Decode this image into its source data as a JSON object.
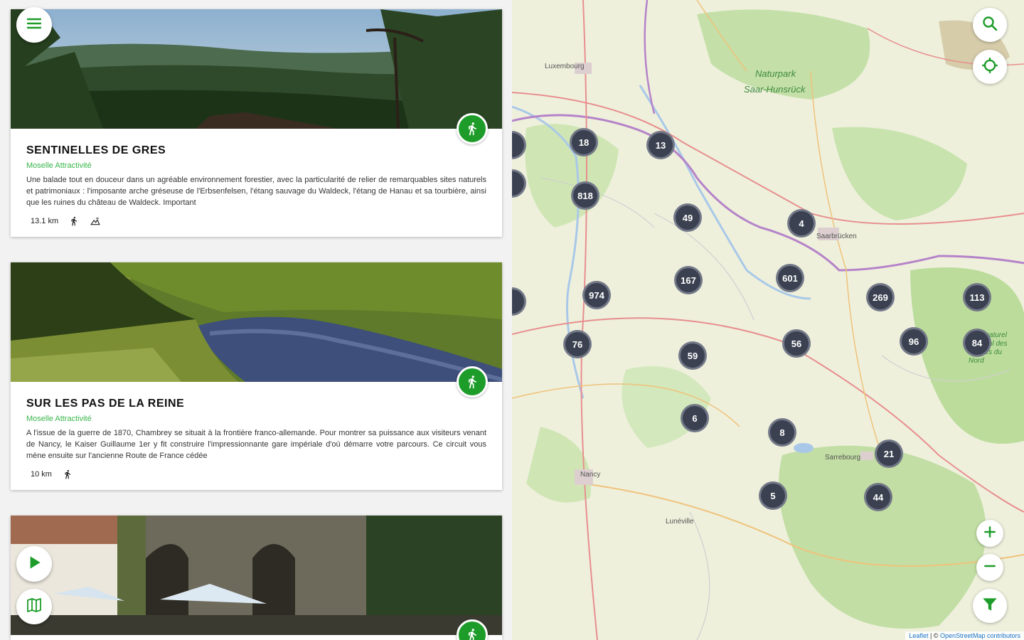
{
  "cards": [
    {
      "title": "SENTINELLES DE GRES",
      "source": "Moselle Attractivité",
      "description": "Une balade tout en douceur dans un agréable environnement forestier, avec la particularité de relier de remarquables sites naturels et patrimoniaux : l'imposante arche gréseuse de l'Erbsenfelsen, l'étang sauvage du Waldeck, l'étang de Hanau et sa tourbière, ainsi que les ruines du château de Waldeck. Important",
      "distance": "13.1 km",
      "activity_icon": "hiking-icon",
      "extra_icon": "elevation-icon"
    },
    {
      "title": "SUR LES PAS DE LA REINE",
      "source": "Moselle Attractivité",
      "description": "A l'issue de la guerre de 1870, Chambrey se situait à la frontière franco-allemande. Pour montrer sa puissance aux visiteurs venant de Nancy, le Kaiser Guillaume 1er y fit construire l'impressionnante gare impériale d'où démarre votre parcours. Ce circuit vous mène ensuite sur l'ancienne Route de France cédée",
      "distance": "10 km",
      "activity_icon": "hiking-icon"
    }
  ],
  "map": {
    "clusters": [
      "18",
      "13",
      "818",
      "49",
      "4",
      "167",
      "601",
      "974",
      "269",
      "113",
      "76",
      "56",
      "96",
      "84",
      "59",
      "6",
      "8",
      "21",
      "5",
      "44"
    ],
    "labels": {
      "luxembourg": "Luxembourg",
      "naturpark": "Naturpark",
      "saar_hunsruck": "Saar-Hunsrück",
      "nancy": "Nancy",
      "sarrebourg": "Sarrebourg",
      "saarbrucken": "Saarbrücken",
      "luneville": "Lunéville",
      "parc_vosges": "Parc naturel régional des Vosges du Nord"
    },
    "attribution_leaflet": "Leaflet",
    "attribution_sep": " | © ",
    "attribution_osm": "OpenStreetMap contributors"
  },
  "colors": {
    "accent_green": "#1e9c2a",
    "source_green": "#39b54a",
    "cluster_bg": "#3b4150"
  }
}
